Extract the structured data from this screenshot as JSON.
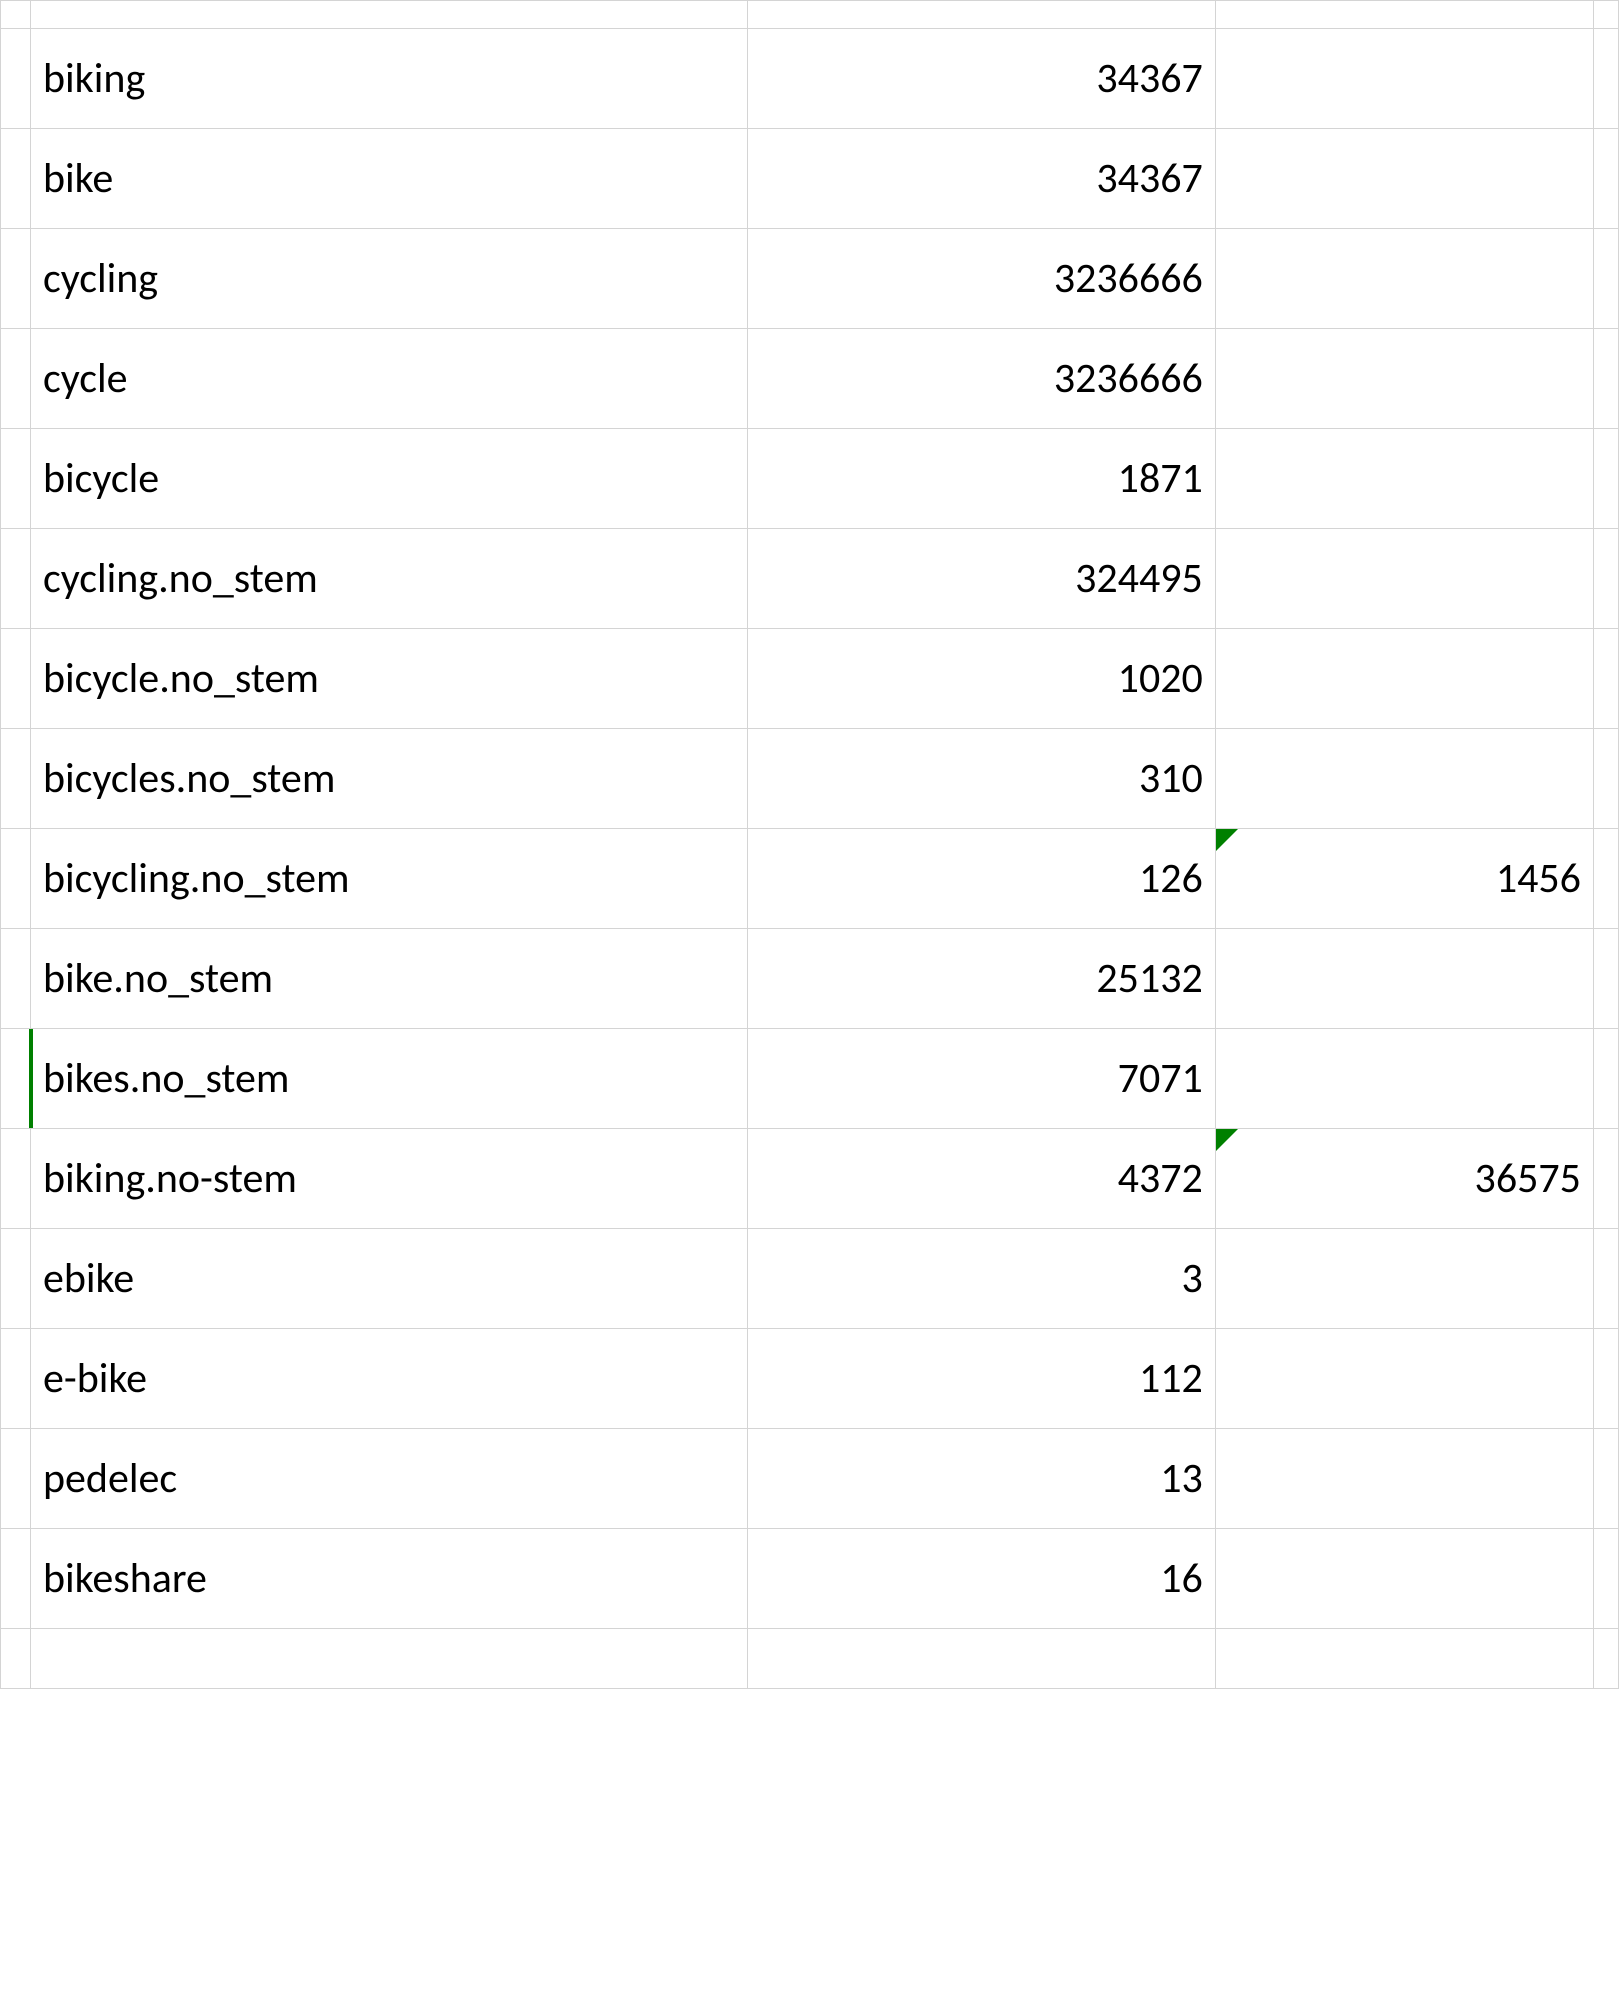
{
  "rows": [
    {
      "label": "biking",
      "value": "34367",
      "extra": "",
      "triangle": false,
      "leftEdge": false
    },
    {
      "label": "bike",
      "value": "34367",
      "extra": "",
      "triangle": false,
      "leftEdge": false
    },
    {
      "label": "cycling",
      "value": "3236666",
      "extra": "",
      "triangle": false,
      "leftEdge": false
    },
    {
      "label": "cycle",
      "value": "3236666",
      "extra": "",
      "triangle": false,
      "leftEdge": false
    },
    {
      "label": "bicycle",
      "value": "1871",
      "extra": "",
      "triangle": false,
      "leftEdge": false
    },
    {
      "label": "cycling.no_stem",
      "value": "324495",
      "extra": "",
      "triangle": false,
      "leftEdge": false
    },
    {
      "label": "bicycle.no_stem",
      "value": "1020",
      "extra": "",
      "triangle": false,
      "leftEdge": false
    },
    {
      "label": "bicycles.no_stem",
      "value": "310",
      "extra": "",
      "triangle": false,
      "leftEdge": false
    },
    {
      "label": "bicycling.no_stem",
      "value": "126",
      "extra": "1456",
      "triangle": true,
      "leftEdge": false
    },
    {
      "label": "bike.no_stem",
      "value": "25132",
      "extra": "",
      "triangle": false,
      "leftEdge": false
    },
    {
      "label": "bikes.no_stem",
      "value": "7071",
      "extra": "",
      "triangle": false,
      "leftEdge": true
    },
    {
      "label": "biking.no-stem",
      "value": "4372",
      "extra": "36575",
      "triangle": true,
      "leftEdge": false
    },
    {
      "label": "ebike",
      "value": "3",
      "extra": "",
      "triangle": false,
      "leftEdge": false
    },
    {
      "label": "e-bike",
      "value": "112",
      "extra": "",
      "triangle": false,
      "leftEdge": false
    },
    {
      "label": "pedelec",
      "value": "13",
      "extra": "",
      "triangle": false,
      "leftEdge": false
    },
    {
      "label": "bikeshare",
      "value": "16",
      "extra": "",
      "triangle": false,
      "leftEdge": false
    }
  ]
}
